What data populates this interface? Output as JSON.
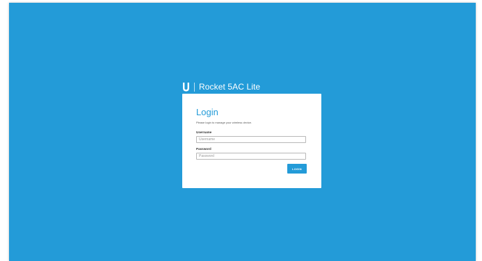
{
  "brand": {
    "logo_icon": "ubiquiti-u-icon",
    "product_name": "Rocket 5AC Lite"
  },
  "login": {
    "title": "Login",
    "subtitle": "Please login to manage your wireless device.",
    "username_label": "Username",
    "username_placeholder": "Username",
    "password_label": "Password",
    "password_placeholder": "Password",
    "button_label": "LOGIN"
  },
  "colors": {
    "background": "#239bd8",
    "accent": "#239bd8",
    "card": "#ffffff"
  }
}
